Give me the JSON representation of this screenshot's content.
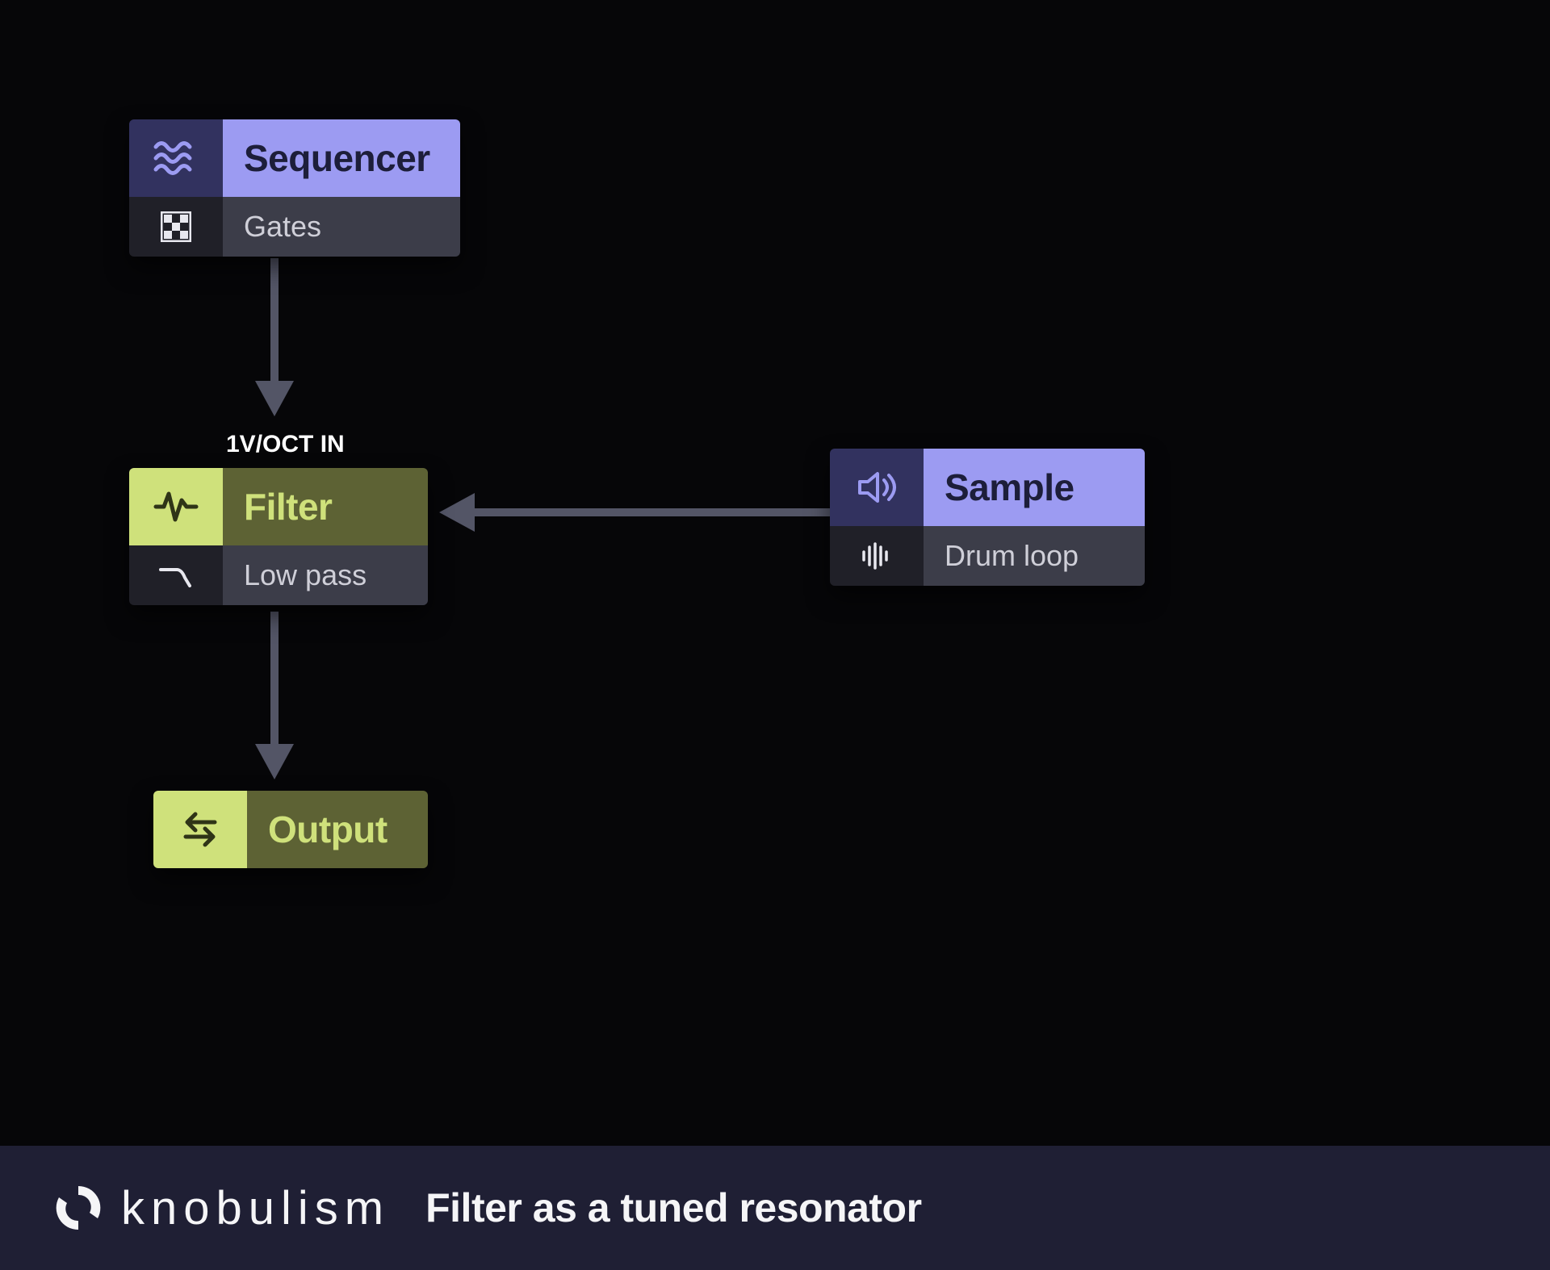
{
  "nodes": {
    "sequencer": {
      "title": "Sequencer",
      "sub": "Gates"
    },
    "filter": {
      "title": "Filter",
      "sub": "Low pass"
    },
    "sample": {
      "title": "Sample",
      "sub": "Drum loop"
    },
    "output": {
      "title": "Output"
    }
  },
  "annotations": {
    "filter_input": "1V/OCT IN"
  },
  "footer": {
    "brand": "knobulism",
    "caption": "Filter as a tuned resonator"
  },
  "palette": {
    "violet_light": "#9c9bf2",
    "violet_dark": "#32325f",
    "chart_light": "#cfe17b",
    "chart_dark": "#5d6234",
    "connector": "#535566"
  },
  "connections": [
    {
      "from": "sequencer",
      "to": "filter",
      "into": "1V/OCT IN"
    },
    {
      "from": "sample",
      "to": "filter"
    },
    {
      "from": "filter",
      "to": "output"
    }
  ]
}
